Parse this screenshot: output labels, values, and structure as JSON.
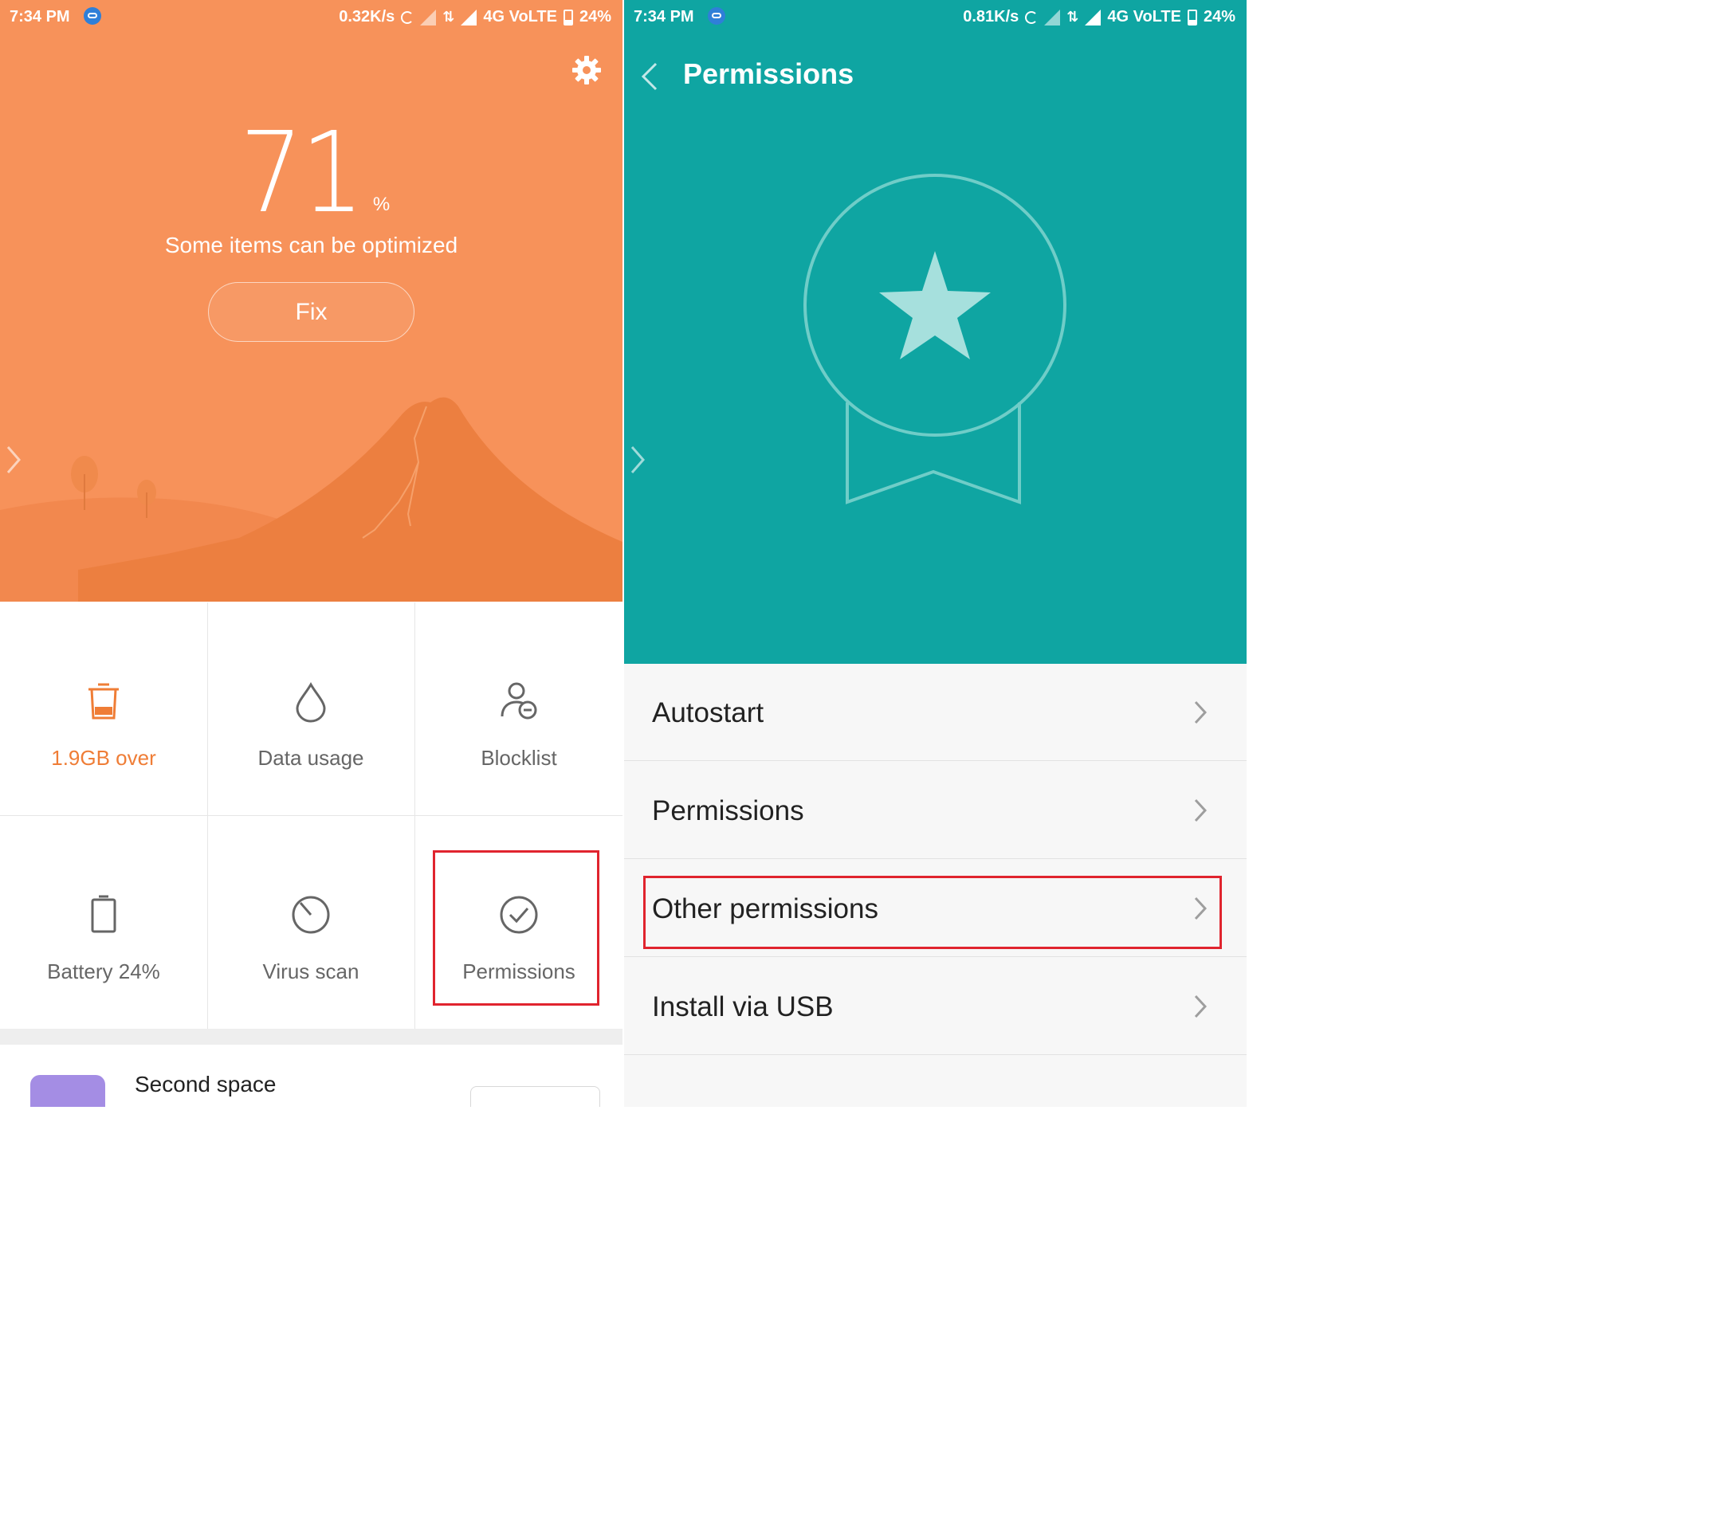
{
  "left": {
    "status": {
      "time": "7:34 PM",
      "speed": "0.32K/s",
      "network": "4G VoLTE",
      "battery": "24%"
    },
    "score": {
      "value": "71",
      "unit": "%"
    },
    "subtitle": "Some items can be optimized",
    "fix_label": "Fix",
    "tiles": [
      {
        "label": "1.9GB over",
        "icon": "trash-icon"
      },
      {
        "label": "Data usage",
        "icon": "droplet-icon"
      },
      {
        "label": "Blocklist",
        "icon": "user-block-icon"
      },
      {
        "label": "Battery 24%",
        "icon": "battery-icon"
      },
      {
        "label": "Virus scan",
        "icon": "virus-scan-icon"
      },
      {
        "label": "Permissions",
        "icon": "check-circle-icon"
      }
    ],
    "second_space": {
      "title": "Second space"
    }
  },
  "right": {
    "status": {
      "time": "7:34 PM",
      "speed": "0.81K/s",
      "network": "4G VoLTE",
      "battery": "24%"
    },
    "title": "Permissions",
    "items": [
      {
        "label": "Autostart"
      },
      {
        "label": "Permissions"
      },
      {
        "label": "Other permissions"
      },
      {
        "label": "Install via USB"
      }
    ]
  },
  "colors": {
    "orange_header": "#f7925a",
    "teal_header": "#0fa5a2",
    "highlight": "#e0242e",
    "accent_orange": "#ef7d36"
  }
}
